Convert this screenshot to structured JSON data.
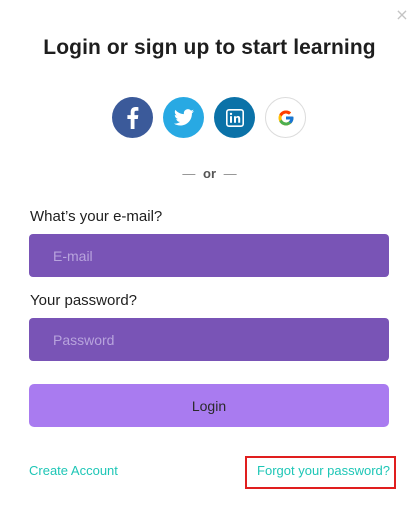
{
  "dialog": {
    "close_glyph": "×",
    "title": "Login or sign up to start learning"
  },
  "social": {
    "buttons": [
      {
        "name": "facebook",
        "color": "#3b5a9a"
      },
      {
        "name": "twitter",
        "color": "#28a9e3"
      },
      {
        "name": "linkedin",
        "color": "#0b72a8"
      },
      {
        "name": "google",
        "color": "#ffffff"
      }
    ]
  },
  "separator": {
    "dash_left": "—",
    "text": "or",
    "dash_right": "—"
  },
  "form": {
    "email_label": "What’s your e-mail?",
    "email_placeholder": "E-mail",
    "email_value": "",
    "password_label": "Your password?",
    "password_placeholder": "Password",
    "password_value": "",
    "login_label": "Login"
  },
  "links": {
    "create_account": "Create Account",
    "forgot_password": "Forgot your password?"
  },
  "colors": {
    "input_bg": "#7954b6",
    "button_bg": "#a97bf0",
    "link": "#1ec6b6",
    "highlight_box": "#e01e1e"
  }
}
